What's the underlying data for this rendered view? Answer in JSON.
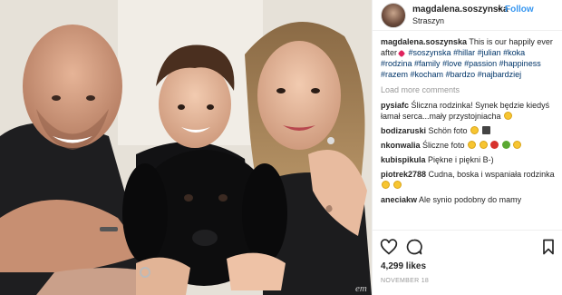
{
  "post": {
    "username": "magdalena.soszynska",
    "separator": "•",
    "follow_label": "Follow",
    "location": "Straszyn",
    "caption_user": "magdalena.soszynska",
    "caption_text": "This is our happily ever after",
    "hashtags": [
      "#soszynska",
      "#hillar",
      "#julian",
      "#koka",
      "#rodzina",
      "#family",
      "#love",
      "#passion",
      "#happiness",
      "#razem",
      "#kocham",
      "#bardzo",
      "#najbardziej"
    ],
    "load_more_label": "Load more comments",
    "likes": "4,299 likes",
    "date": "NOVEMBER 18",
    "watermark": "em"
  },
  "comments": [
    {
      "user": "pysiafc",
      "text": "Śliczna rodzinka! Synek będzie kiedyś łamał serca...mały przystojniacha"
    },
    {
      "user": "bodizaruski",
      "text": "Schön foto"
    },
    {
      "user": "nkonwalia",
      "text": "Śliczne foto"
    },
    {
      "user": "kubispikula",
      "text": "Piękne i piękni B-)"
    },
    {
      "user": "piotrek2788",
      "text": "Cudna, boska i wspaniała rodzinka"
    },
    {
      "user": "aneciakw",
      "text": "Ale synio podobny do mamy"
    }
  ],
  "icons": {
    "like": "heart-outline-icon",
    "comment": "speech-bubble-icon",
    "save": "bookmark-icon"
  },
  "colors": {
    "follow": "#3897f0",
    "hashtag": "#003569",
    "muted": "#999999",
    "text": "#262626"
  }
}
